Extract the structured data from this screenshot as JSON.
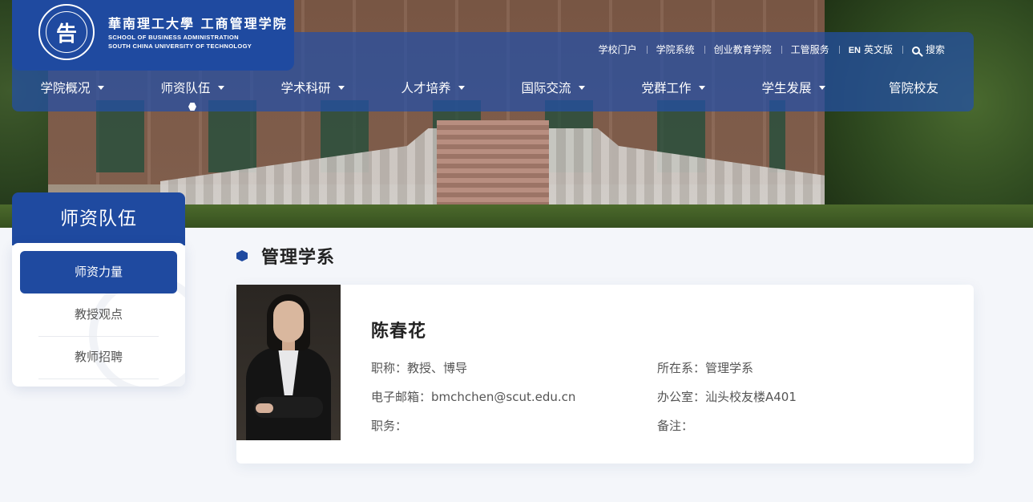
{
  "logo": {
    "emblem_char": "告",
    "title_cn": "華南理工大學 工商管理学院",
    "title_en_1": "SCHOOL OF BUSINESS ADMINISTRATION",
    "title_en_2": "SOUTH CHINA UNIVERSITY OF TECHNOLOGY"
  },
  "utility_links": {
    "school_portal": "学校门户",
    "college_system": "学院系统",
    "entrepreneurship": "创业教育学院",
    "mgmt_service": "工管服务",
    "en_badge": "EN",
    "english": "英文版",
    "search": "搜索"
  },
  "main_nav": {
    "items": [
      {
        "label": "学院概况"
      },
      {
        "label": "师资队伍"
      },
      {
        "label": "学术科研"
      },
      {
        "label": "人才培养"
      },
      {
        "label": "国际交流"
      },
      {
        "label": "党群工作"
      },
      {
        "label": "学生发展"
      },
      {
        "label": "管院校友"
      }
    ],
    "active_index": 1
  },
  "sidebar": {
    "title": "师资队伍",
    "items": [
      {
        "label": "师资力量"
      },
      {
        "label": "教授观点"
      },
      {
        "label": "教师招聘"
      }
    ]
  },
  "section": {
    "title": "管理学系"
  },
  "profile": {
    "name": "陈春花",
    "title": "职称：教授、博导",
    "department": "所在系：管理学系",
    "email": "电子邮箱：bmchchen@scut.edu.cn",
    "office": "办公室：汕头校友楼A401",
    "position": "职务：",
    "remark": "备注："
  },
  "colors": {
    "primary": "#1f4aa0",
    "text": "#555555",
    "heading": "#222222",
    "page_bg": "#f4f6fa"
  }
}
